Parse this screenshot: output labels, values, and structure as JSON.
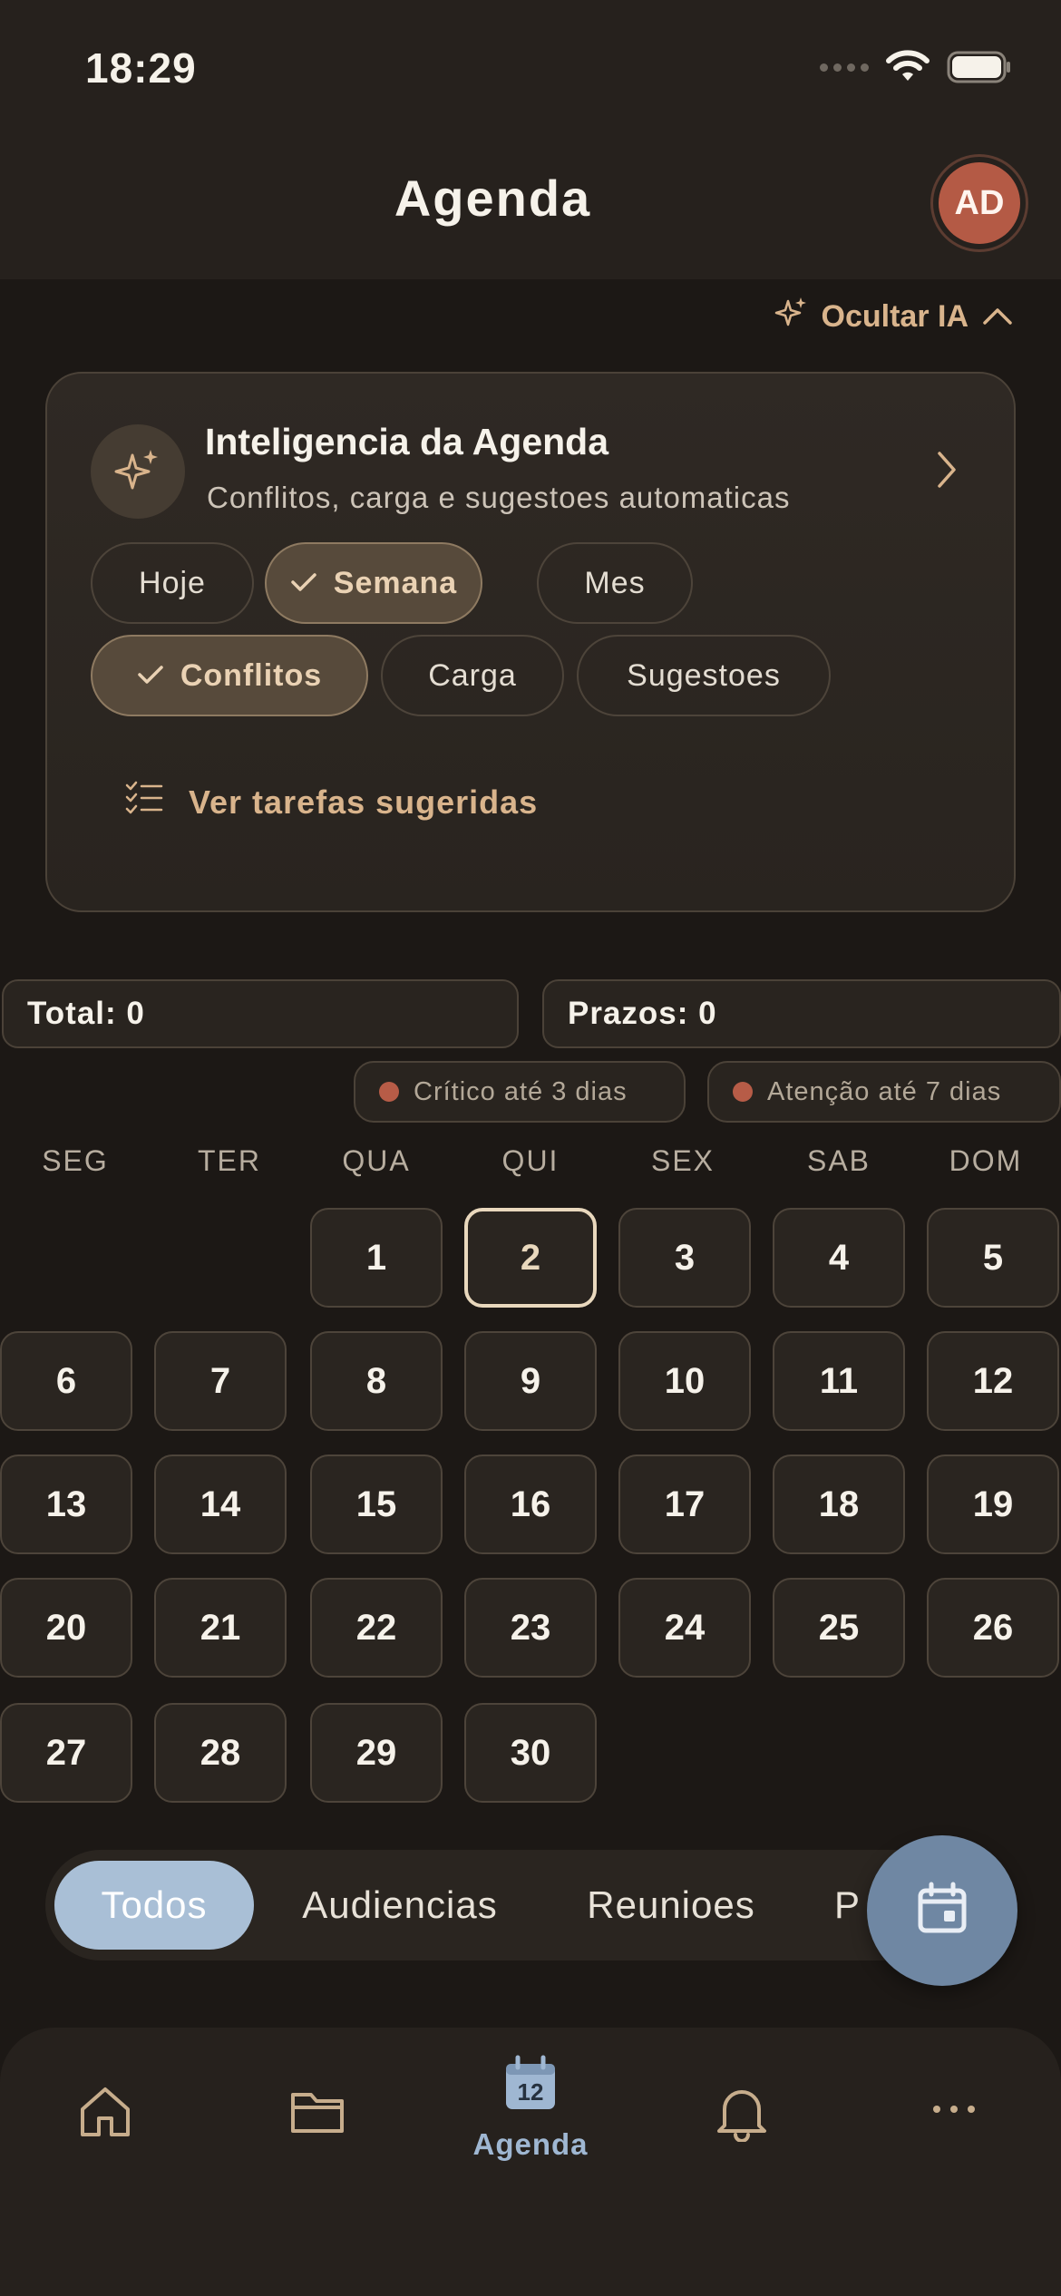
{
  "status_bar": {
    "time": "18:29"
  },
  "header": {
    "title": "Agenda",
    "avatar_initials": "AD"
  },
  "ai_toggle": {
    "label": "Ocultar IA"
  },
  "ai_card": {
    "title": "Inteligencia da Agenda",
    "subtitle": "Conflitos, carga e sugestoes automaticas",
    "period_chips": [
      {
        "label": "Hoje",
        "selected": false
      },
      {
        "label": "Semana",
        "selected": true
      },
      {
        "label": "Mes",
        "selected": false
      }
    ],
    "type_chips": [
      {
        "label": "Conflitos",
        "selected": true
      },
      {
        "label": "Carga",
        "selected": false
      },
      {
        "label": "Sugestoes",
        "selected": false
      }
    ],
    "suggest_link": "Ver tarefas sugeridas"
  },
  "stats": {
    "total": "Total: 0",
    "prazos": "Prazos: 0"
  },
  "legend": {
    "critical": "Crítico até 3 dias",
    "attention": "Atenção até 7 dias"
  },
  "calendar": {
    "weekdays": [
      "SEG",
      "TER",
      "QUA",
      "QUI",
      "SEX",
      "SAB",
      "DOM"
    ],
    "days": [
      "1",
      "2",
      "3",
      "4",
      "5",
      "6",
      "7",
      "8",
      "9",
      "10",
      "11",
      "12",
      "13",
      "14",
      "15",
      "16",
      "17",
      "18",
      "19",
      "20",
      "21",
      "22",
      "23",
      "24",
      "25",
      "26",
      "27",
      "28",
      "29",
      "30"
    ],
    "today": "2"
  },
  "filters": [
    "Todos",
    "Audiencias",
    "Reunioes",
    "P"
  ],
  "bottom_nav": {
    "active_label": "Agenda",
    "calendar_icon_number": "12"
  },
  "colors": {
    "background": "#1c1815",
    "accent_gold": "#d9b48c",
    "avatar": "#b45a45",
    "fab": "#6f87a3",
    "active_filter": "#a9bfd6",
    "critical_dot": "#b75c47"
  }
}
